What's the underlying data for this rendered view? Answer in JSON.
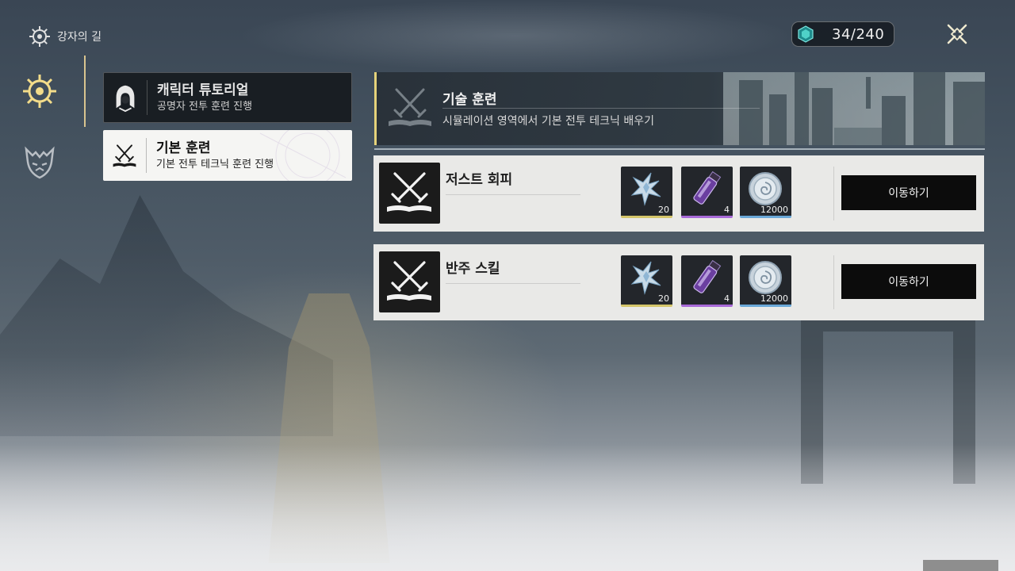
{
  "header": {
    "title": "강자의 길",
    "title_icon": "compass-wheel-icon",
    "currency": {
      "icon": "teal-gem-icon",
      "value": "34/240"
    },
    "close_icon": "close-x-icon"
  },
  "side_nav": [
    {
      "icon": "compass-wheel-icon",
      "active": true
    },
    {
      "icon": "demon-mask-icon",
      "active": false
    }
  ],
  "categories": [
    {
      "name": "캐릭터 튜토리얼",
      "subtitle": "공명자 전투 훈련 진행",
      "icon": "hooded-character-icon",
      "selected": false
    },
    {
      "name": "기본 훈련",
      "subtitle": "기본 전투 테크닉 훈련 진행",
      "icon": "crossed-swords-book-icon",
      "selected": true
    }
  ],
  "section": {
    "title": "기술 훈련",
    "subtitle": "시뮬레이션 영역에서 기본 전투 테크닉 배우기",
    "accent_color": "#e5d27a"
  },
  "trainings": [
    {
      "title": "저스트 회피",
      "icon": "crossed-swords-book-icon",
      "rewards": [
        {
          "icon": "silver-star-crystal-icon",
          "qty": "20"
        },
        {
          "icon": "purple-vial-icon",
          "qty": "4"
        },
        {
          "icon": "shell-coin-icon",
          "qty": "12000"
        }
      ],
      "button": "이동하기"
    },
    {
      "title": "반주 스킬",
      "icon": "crossed-swords-book-icon",
      "rewards": [
        {
          "icon": "silver-star-crystal-icon",
          "qty": "20"
        },
        {
          "icon": "purple-vial-icon",
          "qty": "4"
        },
        {
          "icon": "shell-coin-icon",
          "qty": "12000"
        }
      ],
      "button": "이동하기"
    }
  ]
}
